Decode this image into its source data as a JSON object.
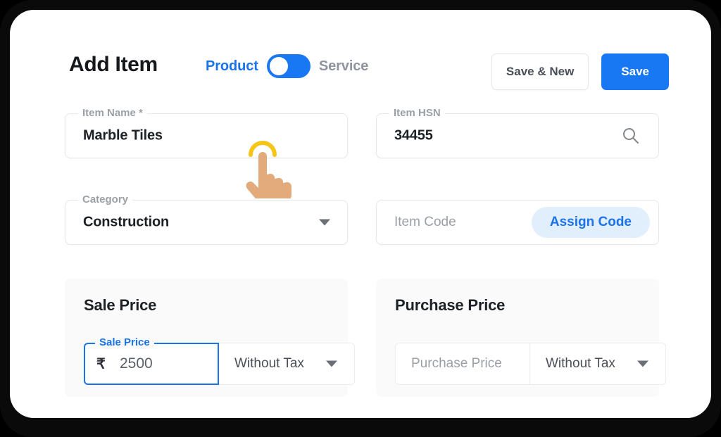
{
  "header": {
    "title": "Add Item",
    "toggle": {
      "left_label": "Product",
      "right_label": "Service",
      "state": "left",
      "on_color": "#1877f2"
    },
    "save_and_new_label": "Save & New",
    "save_label": "Save"
  },
  "fields": {
    "item_name": {
      "legend": "Item Name *",
      "value": "Marble Tiles"
    },
    "item_hsn": {
      "legend": "Item HSN",
      "value": "34455",
      "icon": "search-icon"
    },
    "category": {
      "legend": "Category",
      "value": "Construction",
      "icon": "chevron-down-icon"
    },
    "item_code": {
      "placeholder": "Item Code",
      "action_label": "Assign Code",
      "action_bg": "#e1effd",
      "action_color": "#1a73e8"
    }
  },
  "sale_price": {
    "card_title": "Sale Price",
    "input_legend": "Sale Price",
    "currency_symbol": "₹",
    "amount": "2500",
    "tax_option": "Without Tax",
    "focus_color": "#1a73e8"
  },
  "purchase_price": {
    "card_title": "Purchase Price",
    "input_placeholder": "Purchase Price",
    "tax_option": "Without Tax"
  },
  "cursor": {
    "icon": "tap-hand-icon",
    "skin_color": "#e0a878",
    "ripple_color": "#f5c518"
  }
}
